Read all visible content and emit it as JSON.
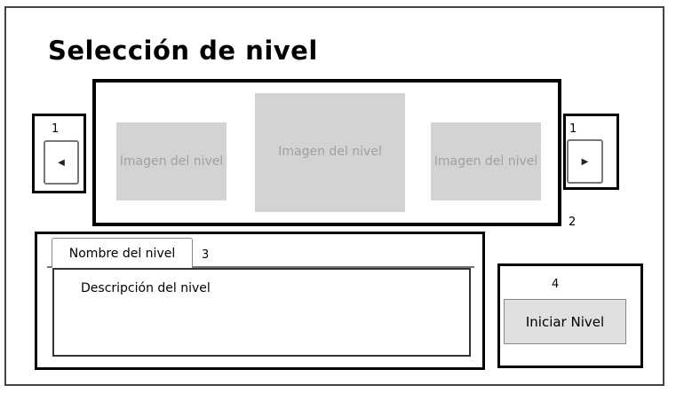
{
  "title": "Selección de nivel",
  "annotations": {
    "prev": "1",
    "next": "1",
    "carousel": "2",
    "level_info": "3",
    "start": "4"
  },
  "nav": {
    "prev_icon": "triangle-left-icon",
    "next_icon": "triangle-right-icon",
    "prev_glyph": "◀",
    "next_glyph": "▶"
  },
  "carousel": {
    "images": [
      "Imagen del nivel",
      "Imagen del nivel",
      "Imagen del nivel"
    ]
  },
  "level": {
    "tab_label": "Nombre del nivel",
    "description": "Descripción del nivel"
  },
  "start_button": "Iniciar Nivel"
}
